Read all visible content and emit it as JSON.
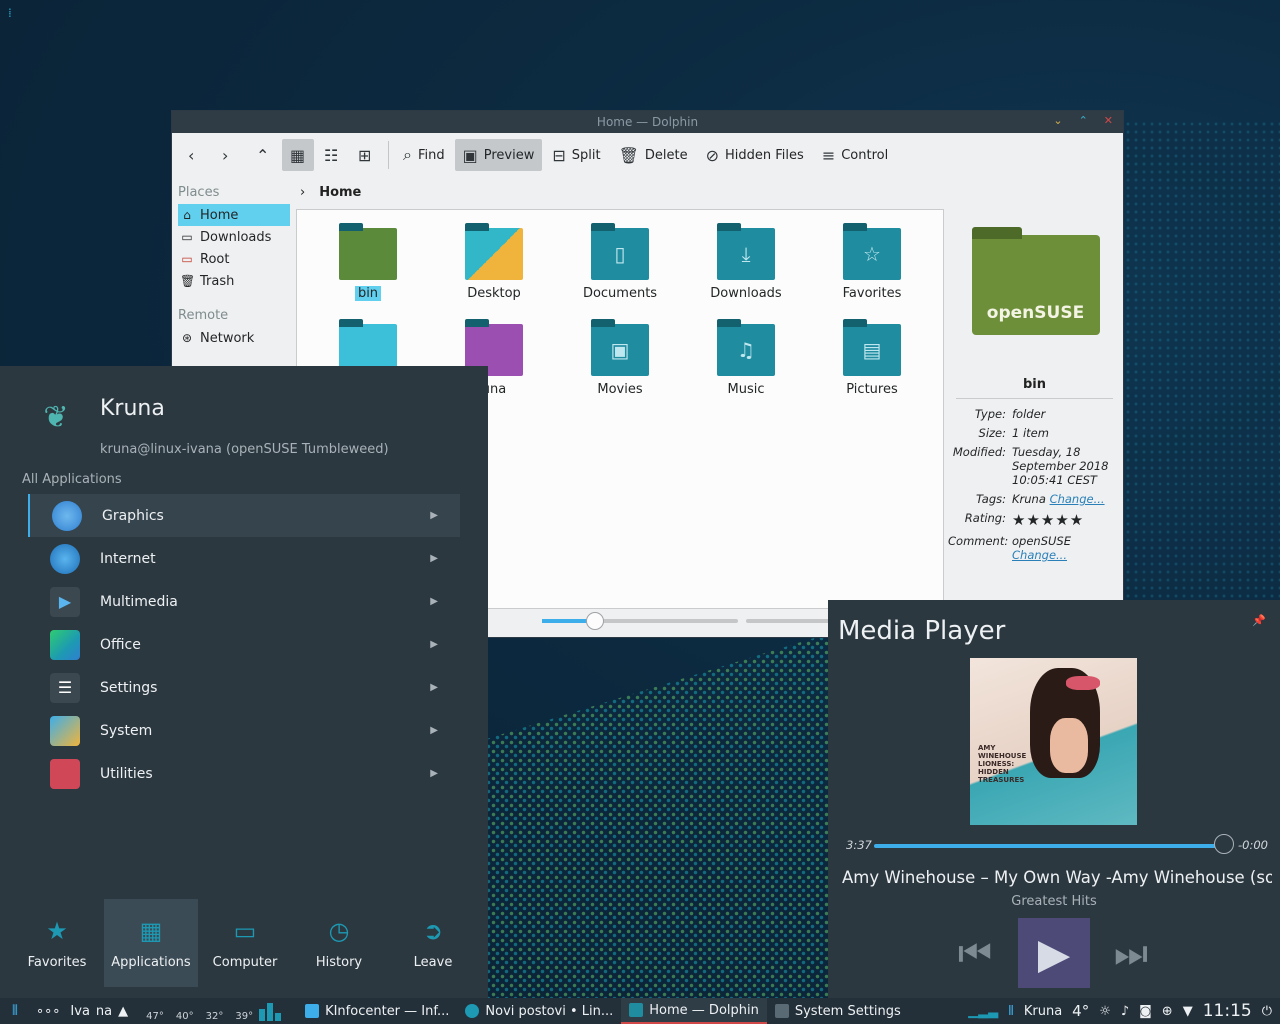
{
  "dolphin": {
    "title": "Home — Dolphin",
    "toolbar": {
      "find": "Find",
      "preview": "Preview",
      "split": "Split",
      "delete": "Delete",
      "hidden_files": "Hidden Files",
      "control": "Control"
    },
    "places": {
      "header": "Places",
      "items": [
        "Home",
        "Downloads",
        "Root",
        "Trash"
      ],
      "remote_header": "Remote",
      "remote_items": [
        "Network"
      ]
    },
    "breadcrumb": "Home",
    "files": [
      {
        "name": "bin"
      },
      {
        "name": "Desktop"
      },
      {
        "name": "Documents"
      },
      {
        "name": "Downloads"
      },
      {
        "name": "Favorites"
      },
      {
        "name": ""
      },
      {
        "name": "una"
      },
      {
        "name": "Movies"
      },
      {
        "name": "Music"
      },
      {
        "name": "Pictures"
      }
    ],
    "info": {
      "folder_text": "openSUSE",
      "title": "bin",
      "type_k": "Type:",
      "type_v": "folder",
      "size_k": "Size:",
      "size_v": "1 item",
      "modified_k": "Modified:",
      "modified_v": "Tuesday, 18 September 2018 10:05:41 CEST",
      "tags_k": "Tags:",
      "tags_v": "Kruna",
      "tags_link": "Change...",
      "rating_k": "Rating:",
      "rating_stars": "★★★★★",
      "comment_k": "Comment:",
      "comment_v": "openSUSE",
      "comment_link": "Change..."
    }
  },
  "kickoff": {
    "user": "Kruna",
    "host": "kruna@linux-ivana (openSUSE Tumbleweed)",
    "section": "All Applications",
    "categories": [
      "Graphics",
      "Internet",
      "Multimedia",
      "Office",
      "Settings",
      "System",
      "Utilities"
    ],
    "tabs": [
      "Favorites",
      "Applications",
      "Computer",
      "History",
      "Leave"
    ]
  },
  "media": {
    "title": "Media Player",
    "elapsed": "3:37",
    "remaining": "-0:00",
    "progress": 1.0,
    "track": "Amy Winehouse – My Own Way -Amy Winehouse (son...",
    "album": "Greatest Hits",
    "cover_text": "AMY WINEHOUSE LIONESS: HIDDEN TREASURES"
  },
  "taskbar": {
    "pager1": "Iva",
    "pager2": "na",
    "temps": [
      "47°",
      "40°",
      "32°",
      "39°"
    ],
    "tasks": [
      "KInfocenter — Inf...",
      "Novi postovi • Lin...",
      "Home — Dolphin",
      "System Settings"
    ],
    "user": "Kruna",
    "weather": "4°",
    "clock": "11:15"
  },
  "colors": {
    "accent": "#3daee9",
    "selection": "#61d0ef",
    "panel": "#2c3840",
    "folder": "#1f8ca0"
  }
}
